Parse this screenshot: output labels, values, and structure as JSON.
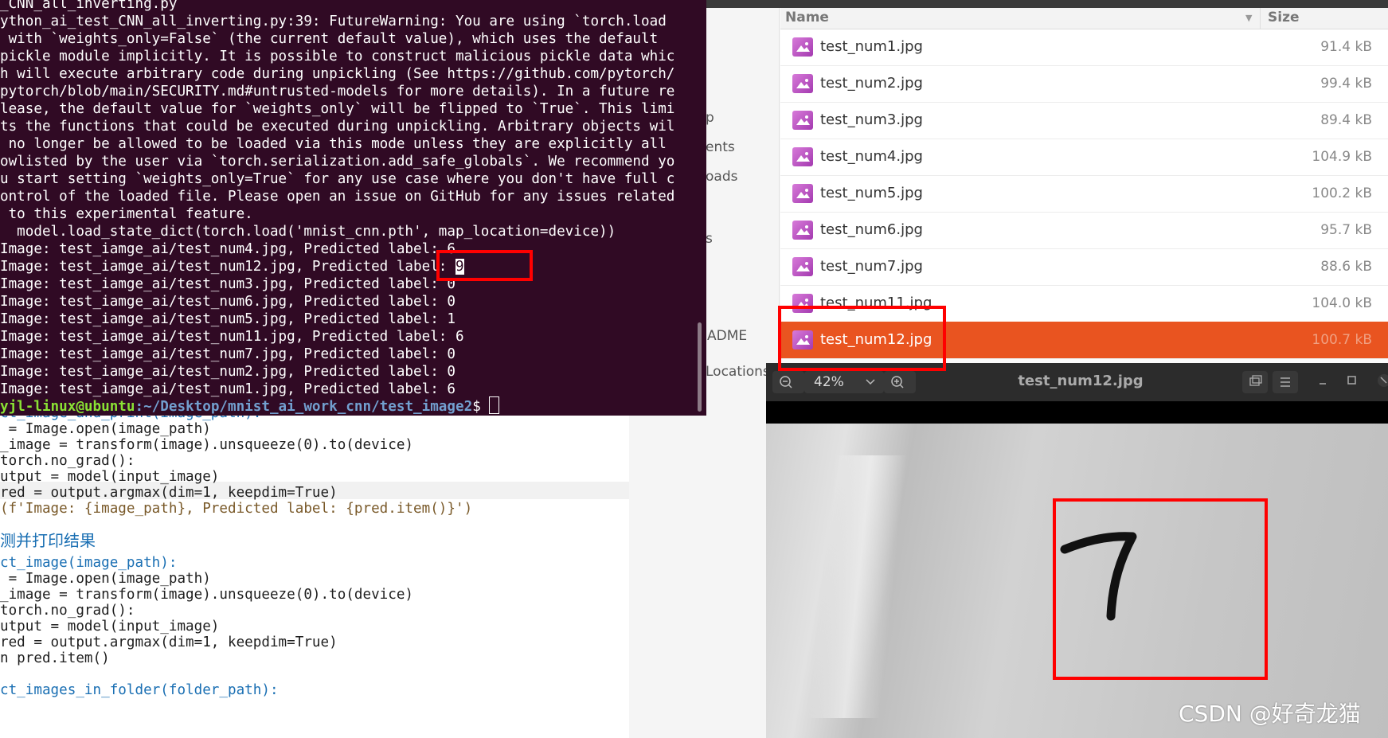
{
  "editor": {
    "lines": [
      "ct_image_and_print(image_path):",
      " = Image.open(image_path)",
      "_image = transform(image).unsqueeze(0).to(device)",
      "torch.no_grad():",
      "utput = model(input_image)",
      "red = output.argmax(dim=1, keepdim=True)",
      "(f'Image: {image_path}, Predicted label: {pred.item()}')",
      "",
      "测并打印结果",
      "ct_image(image_path):",
      " = Image.open(image_path)",
      "_image = transform(image).unsqueeze(0).to(device)",
      "torch.no_grad():",
      "utput = model(input_image)",
      "red = output.argmax(dim=1, keepdim=True)",
      "n pred.item()",
      "",
      "ct_images_in_folder(folder_path):"
    ]
  },
  "terminal": {
    "lines": [
      "_CNN_all_inverting.py",
      "ython_ai_test_CNN_all_inverting.py:39: FutureWarning: You are using `torch.load",
      " with `weights_only=False` (the current default value), which uses the default",
      "pickle module implicitly. It is possible to construct malicious pickle data whic",
      "h will execute arbitrary code during unpickling (See https://github.com/pytorch/",
      "pytorch/blob/main/SECURITY.md#untrusted-models for more details). In a future re",
      "lease, the default value for `weights_only` will be flipped to `True`. This limi",
      "ts the functions that could be executed during unpickling. Arbitrary objects wil",
      " no longer be allowed to be loaded via this mode unless they are explicitly all",
      "owlisted by the user via `torch.serialization.add_safe_globals`. We recommend yo",
      "u start setting `weights_only=True` for any use case where you don't have full c",
      "ontrol of the loaded file. Please open an issue on GitHub for any issues related",
      " to this experimental feature.",
      "  model.load_state_dict(torch.load('mnist_cnn.pth', map_location=device))",
      "Image: test_iamge_ai/test_num4.jpg, Predicted label: 6",
      "Image: test_iamge_ai/test_num12.jpg, Predicted label: ",
      "Image: test_iamge_ai/test_num3.jpg, Predicted label: 0",
      "Image: test_iamge_ai/test_num6.jpg, Predicted label: 0",
      "Image: test_iamge_ai/test_num5.jpg, Predicted label: 1",
      "Image: test_iamge_ai/test_num11.jpg, Predicted label: 6",
      "Image: test_iamge_ai/test_num7.jpg, Predicted label: 0",
      "Image: test_iamge_ai/test_num2.jpg, Predicted label: 0",
      "Image: test_iamge_ai/test_num1.jpg, Predicted label: 6"
    ],
    "highlighted_label": "9",
    "prompt_user": "yjl-linux@ubuntu",
    "prompt_path": ":~/Desktop/mnist_ai_work_cnn/test_image2",
    "prompt_symbol": "$ "
  },
  "file_manager": {
    "sidebar": [
      "p",
      "ents",
      "oads",
      "s",
      "ADME",
      "Locations"
    ],
    "columns": {
      "name": "Name",
      "size": "Size"
    },
    "files": [
      {
        "name": "test_num1.jpg",
        "size": "91.4 kB",
        "selected": false
      },
      {
        "name": "test_num2.jpg",
        "size": "99.4 kB",
        "selected": false
      },
      {
        "name": "test_num3.jpg",
        "size": "89.4 kB",
        "selected": false
      },
      {
        "name": "test_num4.jpg",
        "size": "104.9 kB",
        "selected": false
      },
      {
        "name": "test_num5.jpg",
        "size": "100.2 kB",
        "selected": false
      },
      {
        "name": "test_num6.jpg",
        "size": "95.7 kB",
        "selected": false
      },
      {
        "name": "test_num7.jpg",
        "size": "88.6 kB",
        "selected": false
      },
      {
        "name": "test_num11.jpg",
        "size": "104.0 kB",
        "selected": false
      },
      {
        "name": "test_num12.jpg",
        "size": "100.7 kB",
        "selected": true
      }
    ],
    "selection_color": "#e95420"
  },
  "image_viewer": {
    "zoom": "42%",
    "title": "test_num12.jpg",
    "digit": "7"
  },
  "watermark": "CSDN @好奇龙猫",
  "colors": {
    "terminal_bg": "#300a24",
    "annotation_red": "#ff0000",
    "accent": "#e95420"
  }
}
